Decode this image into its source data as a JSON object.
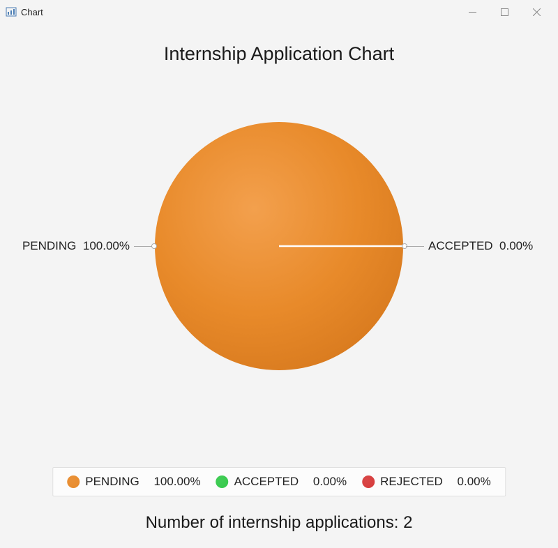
{
  "window": {
    "title": "Chart"
  },
  "chart": {
    "title": "Internship Application Chart",
    "slices": [
      {
        "label": "PENDING",
        "percent_text": "100.00%",
        "color": "#e88a2a"
      },
      {
        "label": "ACCEPTED",
        "percent_text": "0.00%",
        "color": "#35c94b"
      },
      {
        "label": "REJECTED",
        "percent_text": "0.00%",
        "color": "#d63a3a"
      }
    ],
    "callouts": {
      "left": {
        "label": "PENDING",
        "percent_text": "100.00%"
      },
      "right": {
        "label": "ACCEPTED",
        "percent_text": "0.00%"
      }
    },
    "footer": "Number of internship applications: 2"
  },
  "chart_data": {
    "type": "pie",
    "title": "Internship Application Chart",
    "categories": [
      "PENDING",
      "ACCEPTED",
      "REJECTED"
    ],
    "values": [
      100.0,
      0.0,
      0.0
    ],
    "series": [
      {
        "name": "PENDING",
        "values": [
          100.0
        ],
        "color": "#e88a2a"
      },
      {
        "name": "ACCEPTED",
        "values": [
          0.0
        ],
        "color": "#35c94b"
      },
      {
        "name": "REJECTED",
        "values": [
          0.0
        ],
        "color": "#d63a3a"
      }
    ],
    "annotations": [
      "Number of internship applications: 2"
    ]
  }
}
